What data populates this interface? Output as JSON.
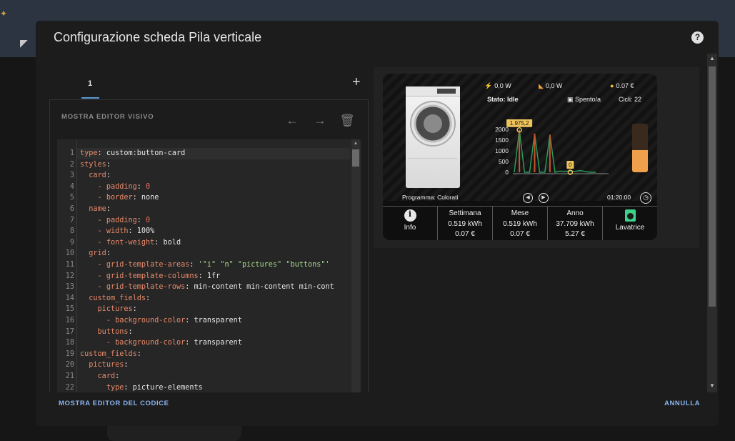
{
  "dialog": {
    "title": "Configurazione scheda Pila verticale",
    "help_icon": "?"
  },
  "tabs": [
    {
      "label": "1",
      "active": true
    }
  ],
  "tab_add": "+",
  "editor": {
    "visual_editor_label": "MOSTRA EDITOR VISIVO",
    "icons": [
      "arrow-left-icon",
      "arrow-right-icon",
      "trash-icon"
    ],
    "code_lines": [
      [
        [
          "k",
          "type"
        ],
        [
          "v",
          ": custom:button-card"
        ]
      ],
      [
        [
          "k",
          "styles"
        ],
        [
          "v",
          ":"
        ]
      ],
      [
        [
          "v",
          "  "
        ],
        [
          "k",
          "card"
        ],
        [
          "v",
          ":"
        ]
      ],
      [
        [
          "v",
          "    "
        ],
        [
          "k",
          "- padding"
        ],
        [
          "v",
          ": "
        ],
        [
          "n",
          "0"
        ]
      ],
      [
        [
          "v",
          "    "
        ],
        [
          "k",
          "- border"
        ],
        [
          "v",
          ": none"
        ]
      ],
      [
        [
          "v",
          "  "
        ],
        [
          "k",
          "name"
        ],
        [
          "v",
          ":"
        ]
      ],
      [
        [
          "v",
          "    "
        ],
        [
          "k",
          "- padding"
        ],
        [
          "v",
          ": "
        ],
        [
          "n",
          "0"
        ]
      ],
      [
        [
          "v",
          "    "
        ],
        [
          "k",
          "- width"
        ],
        [
          "v",
          ": 100%"
        ]
      ],
      [
        [
          "v",
          "    "
        ],
        [
          "k",
          "- font-weight"
        ],
        [
          "v",
          ": bold"
        ]
      ],
      [
        [
          "v",
          "  "
        ],
        [
          "k",
          "grid"
        ],
        [
          "v",
          ":"
        ]
      ],
      [
        [
          "v",
          "    "
        ],
        [
          "k",
          "- grid-template-areas"
        ],
        [
          "v",
          ": "
        ],
        [
          "s",
          "'\"i\" \"n\" \"pictures\" \"buttons\"'"
        ]
      ],
      [
        [
          "v",
          "    "
        ],
        [
          "k",
          "- grid-template-columns"
        ],
        [
          "v",
          ": 1fr"
        ]
      ],
      [
        [
          "v",
          "    "
        ],
        [
          "k",
          "- grid-template-rows"
        ],
        [
          "v",
          ": min-content min-content min-cont"
        ]
      ],
      [
        [
          "v",
          "  "
        ],
        [
          "k",
          "custom_fields"
        ],
        [
          "v",
          ":"
        ]
      ],
      [
        [
          "v",
          "    "
        ],
        [
          "k",
          "pictures"
        ],
        [
          "v",
          ":"
        ]
      ],
      [
        [
          "v",
          "      "
        ],
        [
          "k",
          "- background-color"
        ],
        [
          "v",
          ": transparent"
        ]
      ],
      [
        [
          "v",
          "    "
        ],
        [
          "k",
          "buttons"
        ],
        [
          "v",
          ":"
        ]
      ],
      [
        [
          "v",
          "      "
        ],
        [
          "k",
          "- background-color"
        ],
        [
          "v",
          ": transparent"
        ]
      ],
      [
        [
          "k",
          "custom_fields"
        ],
        [
          "v",
          ":"
        ]
      ],
      [
        [
          "v",
          "  "
        ],
        [
          "k",
          "pictures"
        ],
        [
          "v",
          ":"
        ]
      ],
      [
        [
          "v",
          "    "
        ],
        [
          "k",
          "card"
        ],
        [
          "v",
          ":"
        ]
      ],
      [
        [
          "v",
          "      "
        ],
        [
          "k",
          "type"
        ],
        [
          "v",
          ": picture-elements"
        ]
      ]
    ]
  },
  "preview": {
    "power": "0,0 W",
    "solar": "0,0 W",
    "cost": "0.07 €",
    "status": "Stato: Idle",
    "state": "Spento/a",
    "cycles": "Cicli: 22",
    "program": "Programma: Colorati",
    "time": "01:20:00",
    "gauge_level": 0.45,
    "chart_data": {
      "type": "line",
      "ticks": [
        "2000",
        "1500",
        "1000",
        "500",
        "0"
      ],
      "ylim": [
        0,
        2000
      ],
      "y": [
        0,
        1975.2,
        0,
        0,
        1800,
        0,
        0,
        1750,
        0,
        50,
        40,
        60,
        45,
        80,
        30,
        0,
        0
      ],
      "max_label": "1.975,2",
      "min_label": "0",
      "colors": {
        "line": "#2a9a5a",
        "spike": "#c8542a",
        "marker": "#f0c45a"
      }
    },
    "stats": [
      {
        "label": "Info",
        "icon": "info-icon"
      },
      {
        "title": "Settimana",
        "energy": "0.519 kWh",
        "cost": "0.07 €"
      },
      {
        "title": "Mese",
        "energy": "0.519 kWh",
        "cost": "0.07 €"
      },
      {
        "title": "Anno",
        "energy": "37.709 kWh",
        "cost": "5.27 €"
      },
      {
        "label": "Lavatrice",
        "icon": "washer-icon"
      }
    ]
  },
  "footer": {
    "code_editor": "MOSTRA EDITOR DEL CODICE",
    "cancel": "ANNULLA"
  },
  "colors": {
    "accent": "#8ab4f0",
    "gauge": "#f0a04a"
  }
}
